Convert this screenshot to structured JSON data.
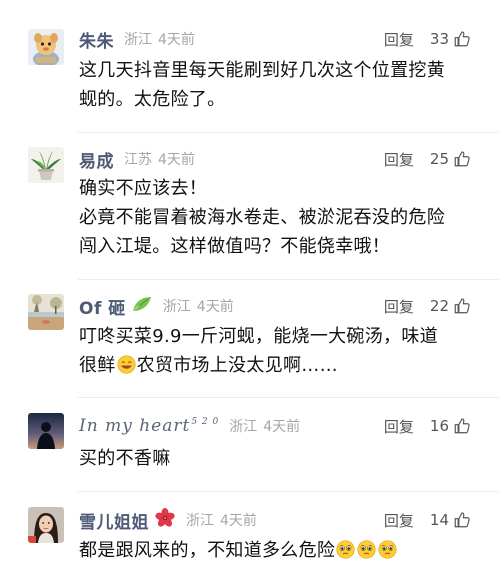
{
  "comments": [
    {
      "username": "朱朱",
      "location": "浙江",
      "time": "4天前",
      "reply_label": "回复",
      "likes": "33",
      "avatar": "cartoon-character-avatar",
      "lines": [
        "这几天抖音里每天能刷到好几次这个位置挖黄",
        "蚬的。太危险了。"
      ]
    },
    {
      "username": "易成",
      "location": "江苏",
      "time": "4天前",
      "reply_label": "回复",
      "likes": "25",
      "avatar": "potted-plant-avatar",
      "lines": [
        "确实不应该去！",
        "必竟不能冒着被海水卷走、被淤泥吞没的危险",
        "闯入江堤。这样做值吗？不能侥幸哦！"
      ]
    },
    {
      "username": "Of 砸",
      "location": "浙江",
      "time": "4天前",
      "reply_label": "回复",
      "likes": "22",
      "avatar": "beach-tree-avatar",
      "badge": "leaf-icon",
      "lines": [
        "叮咚买菜9.9一斤河蚬，能烧一大碗汤，味道",
        "很鲜",
        "农贸市场上没太见啊……"
      ]
    },
    {
      "username": "In my heart",
      "username_sup": "5 2 0",
      "location": "浙江",
      "time": "4天前",
      "reply_label": "回复",
      "likes": "16",
      "avatar": "silhouette-sunset-avatar",
      "lines": [
        "买的不香嘛"
      ]
    },
    {
      "username": "雪儿姐姐",
      "location": "浙江",
      "time": "4天前",
      "reply_label": "回复",
      "likes": "14",
      "avatar": "woman-portrait-avatar",
      "badge": "hibiscus-flower-icon",
      "lines": [
        "都是跟风来的，不知道多么危险"
      ]
    }
  ],
  "colors": {
    "username": "#4d5b74",
    "meta": "#a6a6a6",
    "text": "#111111",
    "divider": "#ececec"
  }
}
